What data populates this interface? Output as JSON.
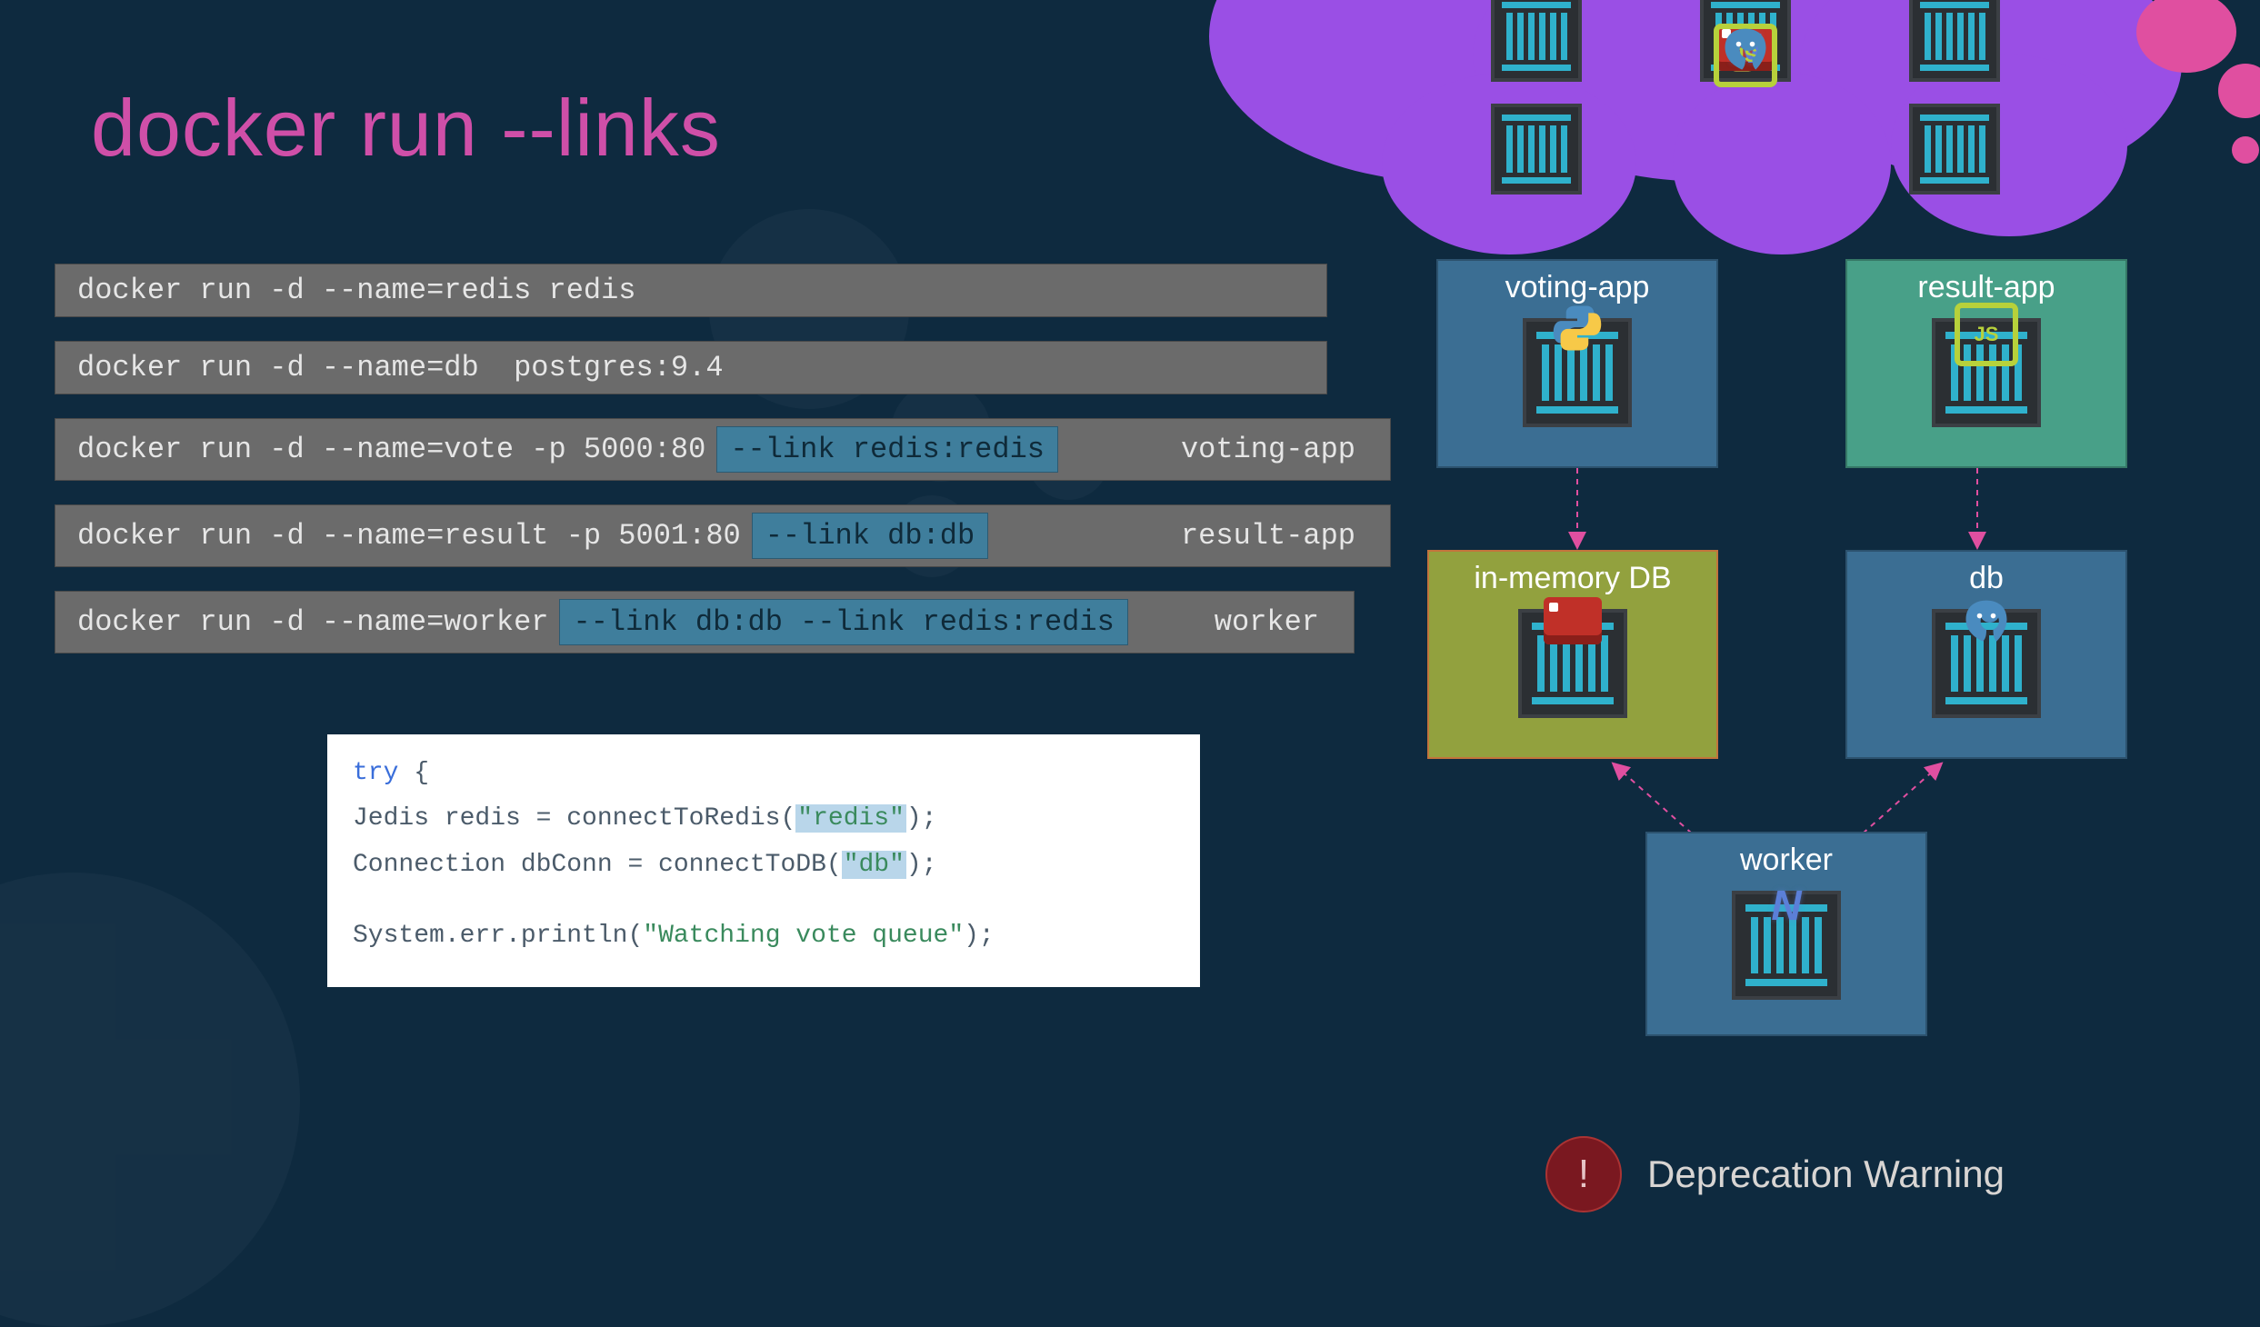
{
  "title": "docker run --links",
  "commands": [
    {
      "pre": "docker run -d --name=redis redis",
      "link": "",
      "post": ""
    },
    {
      "pre": "docker run -d --name=db  postgres:9.4",
      "link": "",
      "post": ""
    },
    {
      "pre": "docker run -d --name=vote -p 5000:80",
      "link": "--link redis:redis",
      "post": "voting-app"
    },
    {
      "pre": "docker run -d --name=result -p 5001:80",
      "link": "--link db:db",
      "post": "result-app"
    },
    {
      "pre": "docker run -d --name=worker",
      "link": "--link db:db --link redis:redis",
      "post": "worker"
    }
  ],
  "snippet": {
    "l1a": "try",
    "l1b": " {",
    "l2a": "    Jedis redis = connectToRedis(",
    "l2s": "\"redis\"",
    "l2b": ");",
    "l3a": "    Connection dbConn = connectToDB(",
    "l3s": "\"db\"",
    "l3b": ");",
    "l4": "    System.err.println(",
    "l4s": "\"Watching vote queue\"",
    "l4b": ");"
  },
  "boxes": {
    "voting": "voting-app",
    "result": "result-app",
    "memdb": "in-memory DB",
    "db": "db",
    "worker": "worker"
  },
  "deprecation": {
    "badge": "!",
    "text": "Deprecation Warning"
  },
  "colors": {
    "title": "#cf4fa8",
    "cloud": "#9a4fe5",
    "highlight": "#3f7e9c"
  }
}
